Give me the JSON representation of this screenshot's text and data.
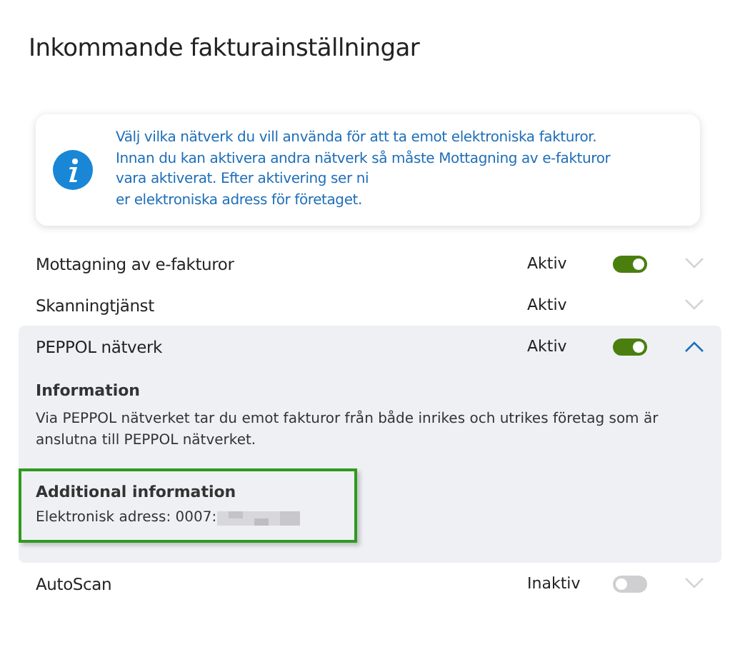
{
  "title": "Inkommande fakturainställningar",
  "info": {
    "lines": [
      "Välj vilka nätverk du vill använda för att ta emot elektroniska fakturor.",
      "Innan du kan aktivera andra nätverk så måste Mottagning av e-fakturor",
      "vara aktiverat. Efter aktivering ser ni",
      "er elektroniska adress för företaget."
    ]
  },
  "services": [
    {
      "name": "Mottagning av e-fakturor",
      "status": "Aktiv",
      "kind": "toggle",
      "on": true,
      "expanded": false
    },
    {
      "name": "Skanningtjänst",
      "status": "Aktiv",
      "kind": "plain",
      "expanded": false
    },
    {
      "name": "PEPPOL nätverk",
      "status": "Aktiv",
      "kind": "toggle",
      "on": true,
      "expanded": true,
      "details": {
        "heading": "Information",
        "text": "Via PEPPOL nätverket tar du emot fakturor från både inrikes och utrikes företag som är anslutna till PEPPOL nätverket.",
        "extra_heading": "Additional information",
        "address": "Elektronisk adress: 0007:"
      }
    },
    {
      "name": "AutoScan",
      "status": "Inaktiv",
      "kind": "toggle",
      "on": false,
      "expanded": false
    }
  ]
}
